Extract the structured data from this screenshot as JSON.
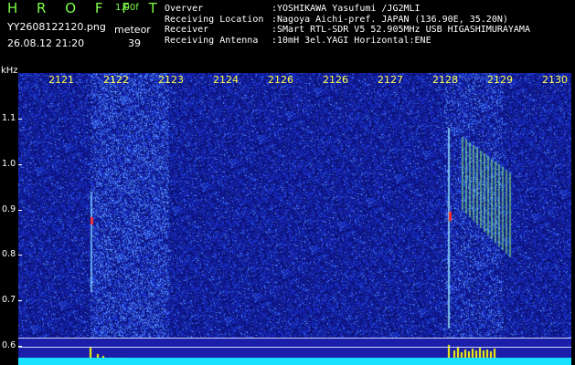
{
  "header": {
    "app_title": "H R O F F T",
    "version": "1.00f",
    "file_name": "YY2608122120.png",
    "date_time": "26.08.12 21:20",
    "meteor_label": "meteor",
    "meteor_count": "39"
  },
  "info": {
    "rows": [
      {
        "key": "Overver",
        "value": ":YOSHIKAWA Yasufumi /JG2MLI"
      },
      {
        "key": "Receiving Location",
        "value": ":Nagoya Aichi-pref. JAPAN (136.90E, 35.20N)"
      },
      {
        "key": "Receiver",
        "value": ":SMart RTL-SDR V5 52.905MHz USB HIGASHIMURAYAMA"
      },
      {
        "key": "Receiving Antenna",
        "value": ":10mH 3el.YAGI Horizontal:ENE"
      }
    ]
  },
  "axes": {
    "y_unit": "kHz",
    "x_ticks": [
      "2121",
      "2122",
      "2123",
      "2124",
      "2126",
      "2126",
      "2127",
      "2128",
      "2129",
      "2130"
    ],
    "y_ticks": [
      "1.1",
      "1.0",
      "0.9",
      "0.8",
      "0.7",
      "0.6"
    ]
  },
  "colors": {
    "background": "#000000",
    "spectrogram_base": "#1a1ea8",
    "time_labels": "#ffff4a",
    "title_green": "#7dff4a",
    "noise_floor": "#18e2ff",
    "meteor_trace": "#ffff00",
    "meteor_hot": "#ff3030"
  }
}
